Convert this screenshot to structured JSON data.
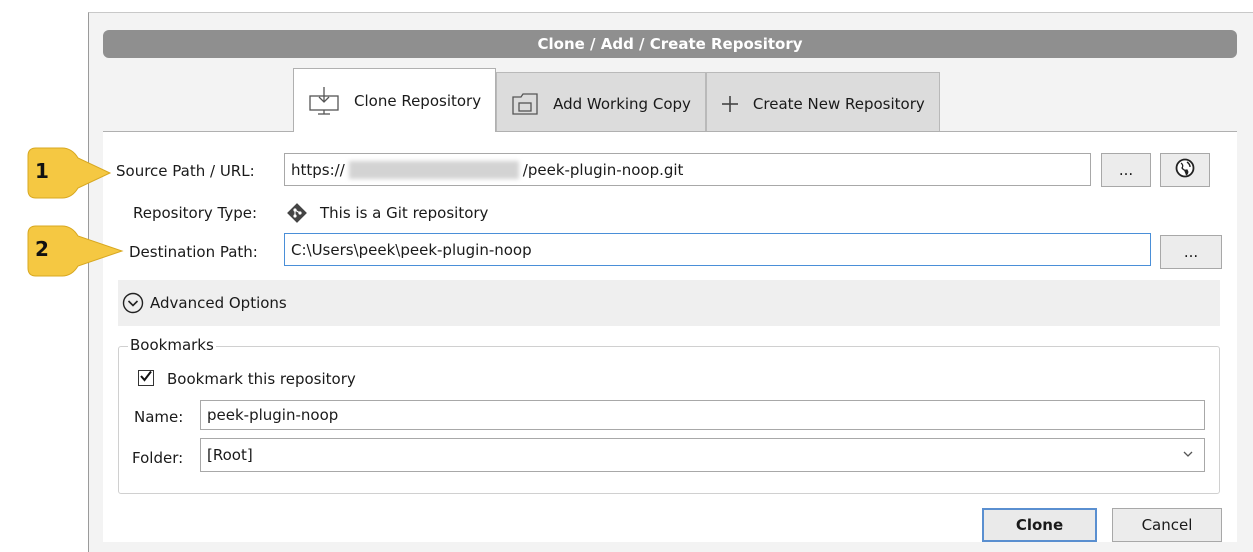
{
  "window": {
    "title": "Clone  / Add / Create Repository"
  },
  "tabs": [
    {
      "label": "Clone Repository",
      "icon": "clone-icon",
      "active": true
    },
    {
      "label": "Add Working Copy",
      "icon": "folder-icon",
      "active": false
    },
    {
      "label": "Create New Repository",
      "icon": "plus-icon",
      "active": false
    }
  ],
  "callouts": [
    "1",
    "2"
  ],
  "form": {
    "source_label": "Source Path / URL:",
    "source_value_prefix": "https://",
    "source_value_suffix": "/peek-plugin-noop.git",
    "browse_label": "...",
    "repo_type_label": "Repository Type:",
    "repo_type_value": "This is a Git repository",
    "dest_label": "Destination Path:",
    "dest_value": "C:\\Users\\peek\\peek-plugin-noop"
  },
  "advanced": {
    "label": "Advanced Options"
  },
  "bookmarks": {
    "group_title": "Bookmarks",
    "checkbox_label": "Bookmark this repository",
    "checked": true,
    "name_label": "Name:",
    "name_value": "peek-plugin-noop",
    "folder_label": "Folder:",
    "folder_value": "[Root]"
  },
  "buttons": {
    "clone": "Clone",
    "cancel": "Cancel"
  },
  "colors": {
    "accent": "#4a8fd8",
    "callout": "#f5c842",
    "titlebar": "#8f8f8f"
  }
}
